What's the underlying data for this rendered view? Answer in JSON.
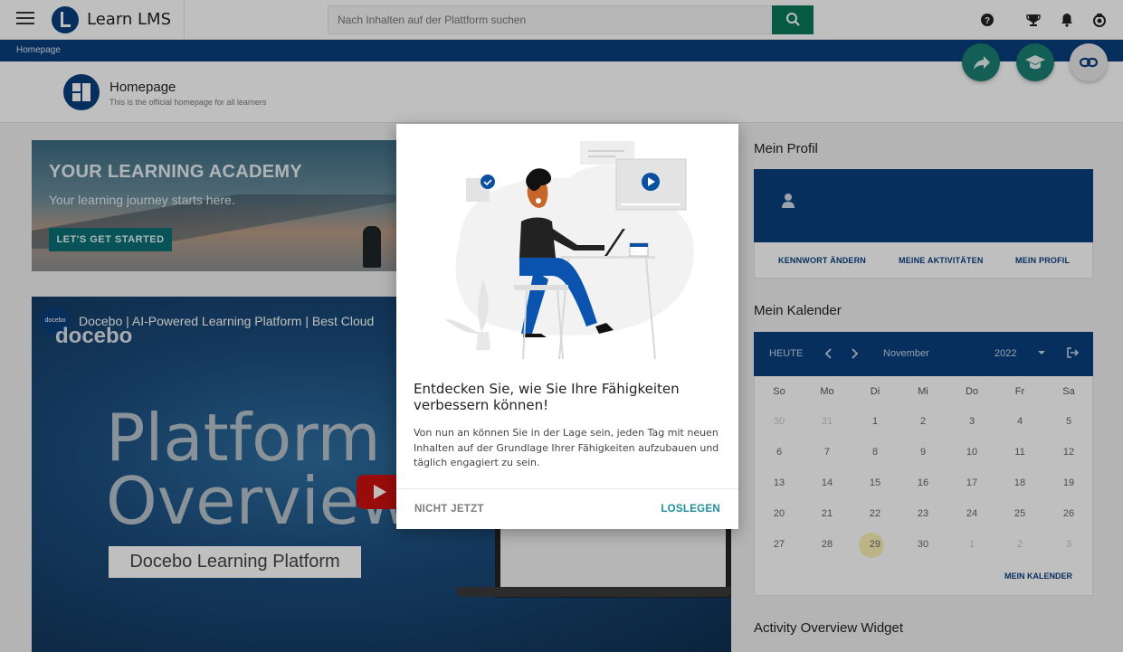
{
  "header": {
    "app_name": "Learn LMS",
    "search_placeholder": "Nach Inhalten auf der Plattform suchen"
  },
  "breadcrumb": {
    "current": "Homepage"
  },
  "page": {
    "title": "Homepage",
    "subtitle": "This is the official homepage for all learners"
  },
  "banner": {
    "title": "YOUR LEARNING ACADEMY",
    "subtitle": "Your learning journey starts here.",
    "button": "LET'S GET STARTED"
  },
  "video": {
    "channel_badge": "docebo",
    "title": "Docebo | AI-Powered Learning Platform | Best Cloud",
    "brand": "docebo",
    "line1": "Platform",
    "line2": "Overview",
    "caption": "Docebo Learning Platform"
  },
  "profile": {
    "heading": "Mein Profil",
    "links": [
      "KENNWORT ÄNDERN",
      "MEINE AKTIVITÄTEN",
      "MEIN PROFIL"
    ]
  },
  "calendar": {
    "heading": "Mein Kalender",
    "today_label": "HEUTE",
    "month": "November",
    "year": "2022",
    "weekdays": [
      "So",
      "Mo",
      "Di",
      "Mi",
      "Do",
      "Fr",
      "Sa"
    ],
    "weeks": [
      [
        "30",
        "31",
        "1",
        "2",
        "3",
        "4",
        "5"
      ],
      [
        "6",
        "7",
        "8",
        "9",
        "10",
        "11",
        "12"
      ],
      [
        "13",
        "14",
        "15",
        "16",
        "17",
        "18",
        "19"
      ],
      [
        "20",
        "21",
        "22",
        "23",
        "24",
        "25",
        "26"
      ],
      [
        "27",
        "28",
        "29",
        "30",
        "1",
        "2",
        "3"
      ]
    ],
    "link": "MEIN KALENDER"
  },
  "activity": {
    "heading": "Activity Overview Widget"
  },
  "modal": {
    "title": "Entdecken Sie, wie Sie Ihre Fähigkeiten verbessern können!",
    "body": "Von nun an können Sie in der Lage sein, jeden Tag mit neuen Inhalten auf der Grundlage Ihrer Fähigkeiten aufzubauen und täglich engagiert zu sein.",
    "secondary_button": "NICHT JETZT",
    "primary_button": "LOSLEGEN"
  },
  "colors": {
    "brand": "#0a3f7d",
    "accent": "#1e8fa0",
    "search_button": "#0b7a5a",
    "today_highlight": "#fbf0b5"
  },
  "icons": [
    "hamburger-icon",
    "search-icon",
    "help-icon",
    "trophy-icon",
    "bell-icon",
    "user-menu-icon",
    "share-icon",
    "graduation-cap-icon",
    "link-icon",
    "user-icon",
    "chevron-left-icon",
    "chevron-right-icon",
    "caret-down-icon",
    "exit-icon",
    "play-icon",
    "check-icon"
  ]
}
